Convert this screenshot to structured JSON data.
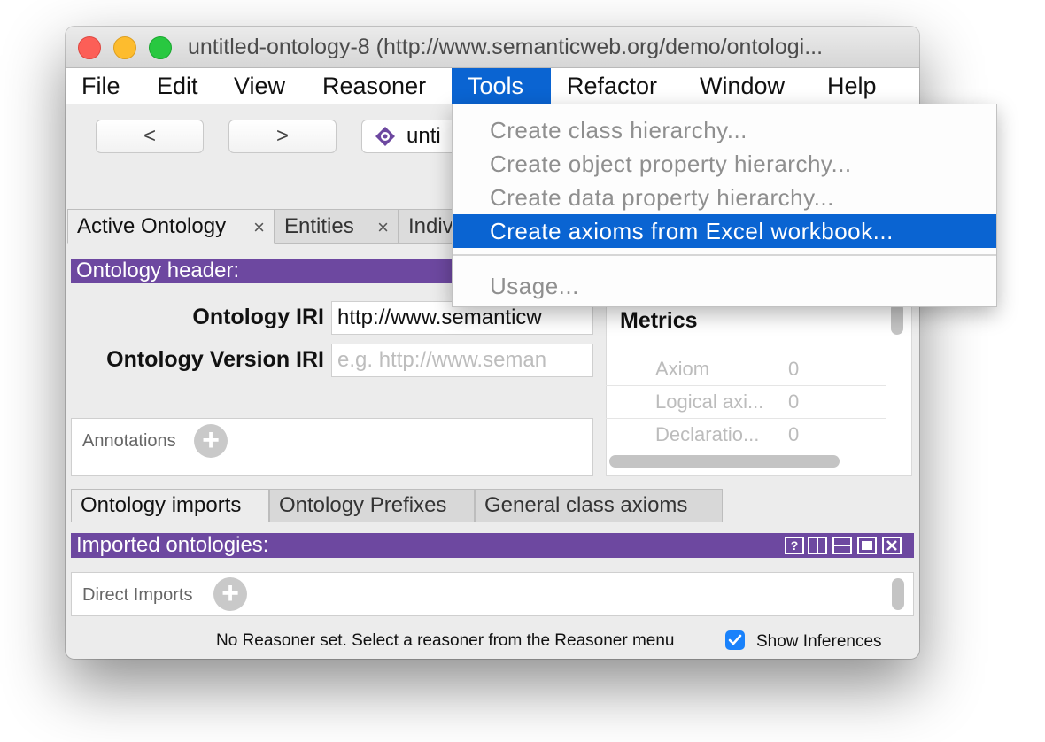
{
  "window": {
    "title": "untitled-ontology-8 (http://www.semanticweb.org/demo/ontologi..."
  },
  "menu": [
    "File",
    "Edit",
    "View",
    "Reasoner",
    "Tools",
    "Refactor",
    "Window",
    "Help"
  ],
  "toolbar": {
    "back": "<",
    "forward": ">",
    "entity_text": "unti"
  },
  "tabs": [
    {
      "label": "Active Ontology",
      "close": "×"
    },
    {
      "label": "Entities",
      "close": "×"
    },
    {
      "label": "Indiv"
    }
  ],
  "header_section": {
    "title": "Ontology header:",
    "iri_label": "Ontology IRI",
    "iri_value": "http://www.semanticw",
    "version_label": "Ontology Version IRI",
    "version_placeholder": "e.g. http://www.seman",
    "annotations_label": "Annotations",
    "add_symbol": "+"
  },
  "metrics": {
    "title": "Metrics",
    "rows": [
      {
        "name": "Axiom",
        "value": "0"
      },
      {
        "name": "Logical axi...",
        "value": "0"
      },
      {
        "name": "Declaratio...",
        "value": "0"
      }
    ]
  },
  "subtabs": [
    "Ontology imports",
    "Ontology Prefixes",
    "General class axioms"
  ],
  "imports_section": {
    "title": "Imported ontologies:",
    "direct_imports_label": "Direct Imports",
    "add_symbol": "+",
    "help_symbol": "?"
  },
  "status": {
    "text": "No Reasoner set. Select a reasoner from the Reasoner menu",
    "show_inferences_label": "Show Inferences",
    "show_inferences_checked": true
  },
  "tools_menu": {
    "items": [
      "Create class hierarchy...",
      "Create object property hierarchy...",
      "Create data property hierarchy...",
      "Create axioms from Excel workbook...",
      "Usage..."
    ],
    "highlighted_index": 3
  },
  "colors": {
    "accent": "#0a64d2",
    "section_bar": "#6d48a0",
    "checkbox": "#1a82fb"
  }
}
